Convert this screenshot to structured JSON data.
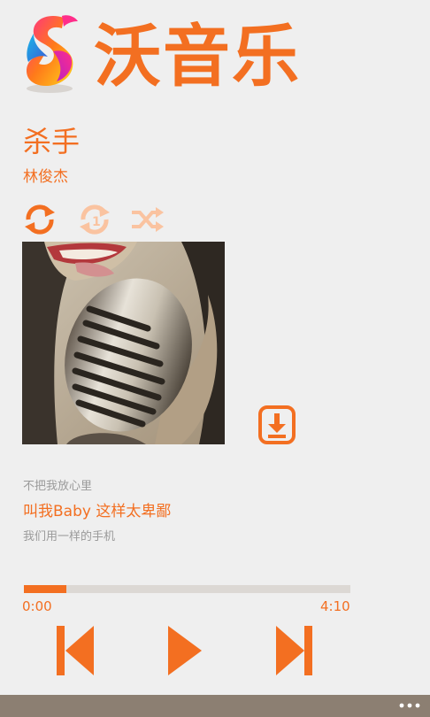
{
  "app": {
    "title": "沃音乐",
    "logo_icon": "wo-music-logo-icon",
    "accent_color": "#f36f21"
  },
  "song": {
    "title": "杀手",
    "artist": "林俊杰"
  },
  "play_modes": [
    {
      "name": "repeat-all-icon",
      "active": true
    },
    {
      "name": "repeat-one-icon",
      "active": false
    },
    {
      "name": "shuffle-icon",
      "active": false
    }
  ],
  "album_art": {
    "icon": "album-cover-microphone"
  },
  "download_icon": "download-icon",
  "lyrics": {
    "previous": "不把我放心里",
    "current": "叫我Baby 这样太卑鄙",
    "next": "我们用一样的手机"
  },
  "playback": {
    "current_time": "0:00",
    "total_time": "4:10",
    "progress_fraction": 0.13
  },
  "controls": {
    "previous_icon": "skip-previous-icon",
    "play_icon": "play-icon",
    "next_icon": "skip-next-icon"
  },
  "app_bar": {
    "more_icon": "more-ellipsis-icon"
  }
}
